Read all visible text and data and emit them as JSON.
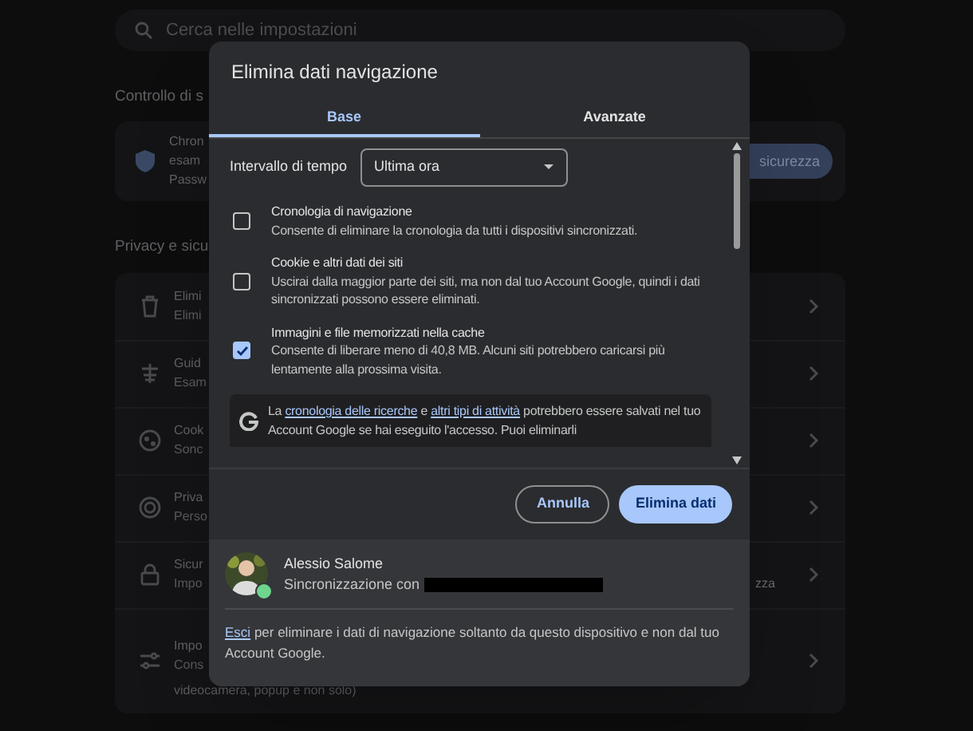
{
  "background": {
    "search": {
      "placeholder": "Cerca nelle impostazioni"
    },
    "safety_heading": "Controllo di s",
    "safety_card": {
      "lines": [
        "Chron",
        "esam",
        "Passw"
      ],
      "button": "sicurezza"
    },
    "privacy_heading": "Privacy e sicu",
    "rows": [
      {
        "kind": "trash",
        "title": "Elimi",
        "subtitle": "Elimi"
      },
      {
        "kind": "guide",
        "title": "Guid",
        "subtitle": "Esam"
      },
      {
        "kind": "cookie",
        "title": "Cook",
        "subtitle": "Sonc"
      },
      {
        "kind": "privacy",
        "title": "Priva",
        "subtitle": "Perso"
      },
      {
        "kind": "lock",
        "title": "Sicur",
        "subtitle": "Impo",
        "trailing": "zza"
      },
      {
        "kind": "sliders",
        "title": "Impo",
        "subtitle": "Cons",
        "extra": "videocamera, popup e non solo)"
      }
    ]
  },
  "dialog": {
    "title": "Elimina dati navigazione",
    "tabs": [
      {
        "label": "Base",
        "selected": true
      },
      {
        "label": "Avanzate",
        "selected": false
      }
    ],
    "time_range": {
      "label": "Intervallo di tempo",
      "value": "Ultima ora"
    },
    "options": [
      {
        "title": "Cronologia di navigazione",
        "description": "Consente di eliminare la cronologia da tutti i dispositivi sincronizzati.",
        "checked": false
      },
      {
        "title": "Cookie e altri dati dei siti",
        "description": "Uscirai dalla maggior parte dei siti, ma non dal tuo Account Google, quindi i dati sincronizzati possono essere eliminati.",
        "checked": false
      },
      {
        "title": "Immagini e file memorizzati nella cache",
        "description": "Consente di liberare meno di 40,8 MB. Alcuni siti potrebbero caricarsi più lentamente alla prossima visita.",
        "checked": true
      }
    ],
    "notice": {
      "before": "La",
      "link1": "cronologia delle ricerche",
      "middle": "e",
      "link2": "altri tipi di attività",
      "after": "potrebbero essere salvati nel tuo Account Google se hai eseguito l'accesso. Puoi eliminarli"
    },
    "buttons": {
      "cancel": "Annulla",
      "confirm": "Elimina dati"
    },
    "account": {
      "name": "Alessio Salome",
      "sync": "Sincronizzazione con"
    },
    "footer": {
      "link": "Esci",
      "text": "per eliminare i dati di navigazione soltanto da questo dispositivo e non dal tuo Account Google."
    }
  }
}
